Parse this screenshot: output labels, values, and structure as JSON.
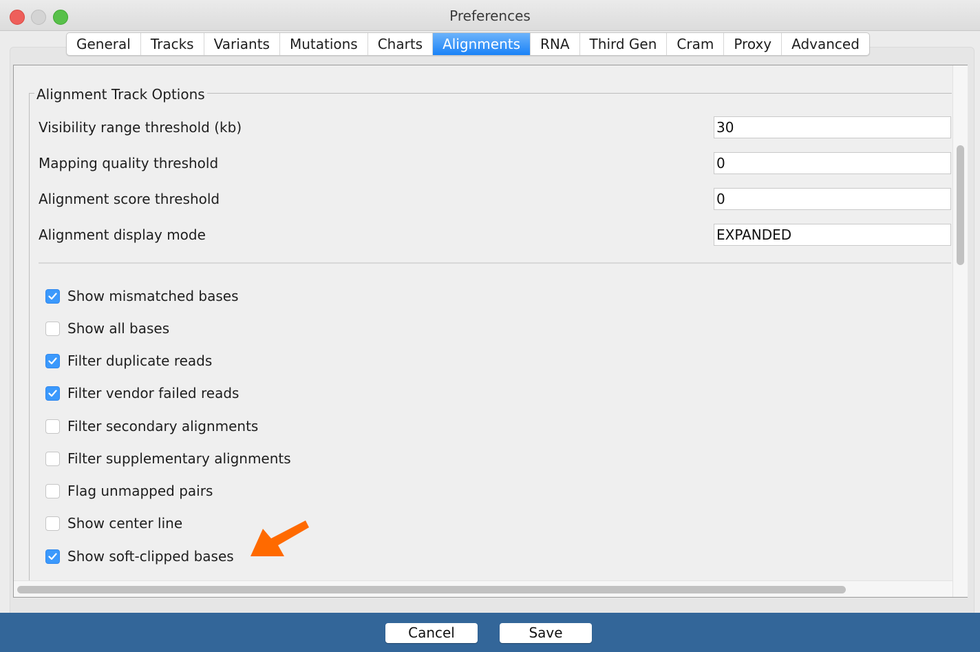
{
  "window": {
    "title": "Preferences"
  },
  "tabs": [
    {
      "label": "General",
      "active": false
    },
    {
      "label": "Tracks",
      "active": false
    },
    {
      "label": "Variants",
      "active": false
    },
    {
      "label": "Mutations",
      "active": false
    },
    {
      "label": "Charts",
      "active": false
    },
    {
      "label": "Alignments",
      "active": true
    },
    {
      "label": "RNA",
      "active": false
    },
    {
      "label": "Third Gen",
      "active": false
    },
    {
      "label": "Cram",
      "active": false
    },
    {
      "label": "Proxy",
      "active": false
    },
    {
      "label": "Advanced",
      "active": false
    }
  ],
  "section": {
    "title": "Alignment Track Options",
    "fields": [
      {
        "label": "Visibility range threshold (kb)",
        "value": "30"
      },
      {
        "label": "Mapping quality threshold",
        "value": "0"
      },
      {
        "label": "Alignment score threshold",
        "value": "0"
      },
      {
        "label": "Alignment display mode",
        "value": "EXPANDED"
      }
    ],
    "checkboxes": [
      {
        "label": "Show mismatched bases",
        "checked": true
      },
      {
        "label": "Show all bases",
        "checked": false
      },
      {
        "label": "Filter duplicate reads",
        "checked": true
      },
      {
        "label": "Filter vendor failed reads",
        "checked": true
      },
      {
        "label": "Filter secondary alignments",
        "checked": false
      },
      {
        "label": "Filter supplementary alignments",
        "checked": false
      },
      {
        "label": "Flag unmapped pairs",
        "checked": false
      },
      {
        "label": "Show center line",
        "checked": false
      },
      {
        "label": "Show soft-clipped bases",
        "checked": true
      }
    ]
  },
  "annotation": {
    "icon": "arrow-annotation-icon",
    "color": "#ff6a00"
  },
  "footer": {
    "cancel_label": "Cancel",
    "save_label": "Save"
  },
  "colors": {
    "active_tab": "#1a82f7",
    "checkbox": "#3b99fc",
    "footer_bg": "#336699"
  }
}
